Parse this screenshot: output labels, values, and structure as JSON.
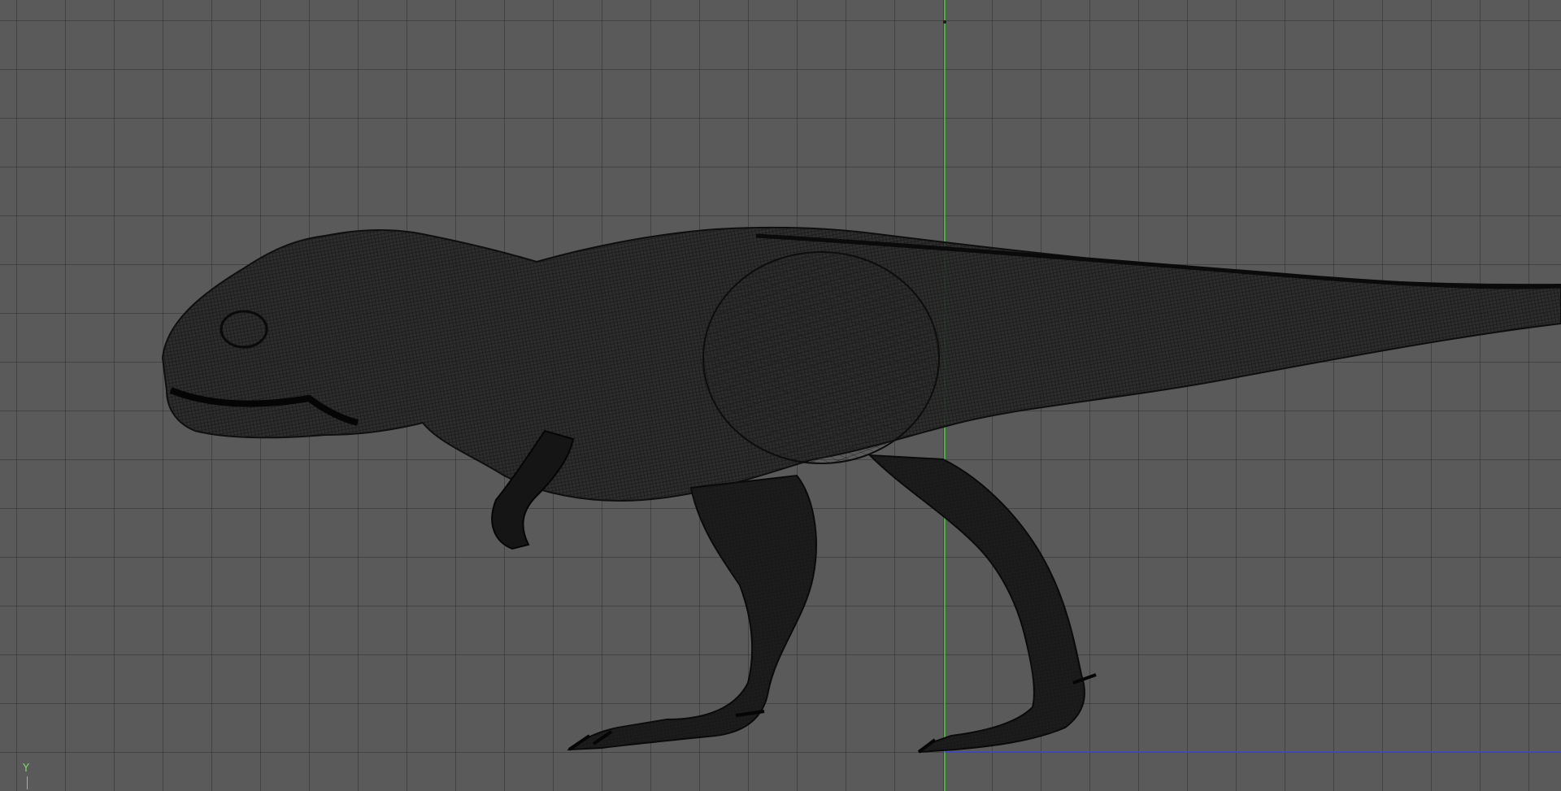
{
  "viewport": {
    "background_color": "#5a5a5a",
    "grid_color": "#4a4a4a",
    "axis_y_color": "#3fd23a",
    "axis_x_color": "#3d49c9",
    "model_color": "#111111",
    "axis_label": "Y"
  }
}
